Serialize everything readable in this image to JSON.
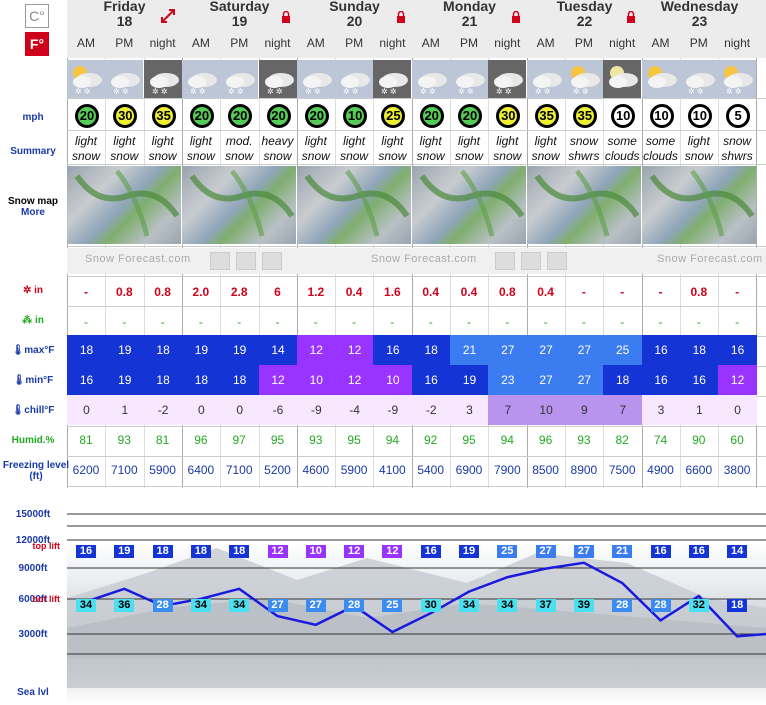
{
  "units": {
    "celsius": "C°",
    "fahrenheit": "F°"
  },
  "days": [
    {
      "name": "Friday",
      "date": "18",
      "icon": "expand-icon"
    },
    {
      "name": "Saturday",
      "date": "19",
      "icon": "lock-icon"
    },
    {
      "name": "Sunday",
      "date": "20",
      "icon": "lock-icon"
    },
    {
      "name": "Monday",
      "date": "21",
      "icon": "lock-icon"
    },
    {
      "name": "Tuesday",
      "date": "22",
      "icon": "lock-icon"
    },
    {
      "name": "Wednesday",
      "date": "23",
      "icon": ""
    }
  ],
  "periods": [
    "AM",
    "PM",
    "night",
    "AM",
    "PM",
    "night",
    "AM",
    "PM",
    "night",
    "AM",
    "PM",
    "night",
    "AM",
    "PM",
    "night",
    "AM",
    "PM",
    "night"
  ],
  "weather_icons": [
    "sun-cloud-snow",
    "cloud-snow",
    "night-cloud-snow",
    "cloud-snow",
    "cloud-snow",
    "night-heavy-snow",
    "cloud-snow",
    "cloud-snow",
    "night-cloud-snow",
    "cloud-snow",
    "cloud-snow",
    "night-cloud-snow",
    "cloud-snow",
    "sun-cloud-snow",
    "moon-cloud",
    "sun-cloud",
    "cloud-snow",
    "sun-cloud-snow"
  ],
  "labels": {
    "wind": "mph",
    "summary": "Summary",
    "snow_map": "Snow map",
    "snow_map_more": "More",
    "snow": "in",
    "rain": "in",
    "max": "max°F",
    "min": "min°F",
    "chill": "chill°F",
    "humid": "Humid.%",
    "freezing": "Freezing level (ft)",
    "alt_15000": "15000ft",
    "alt_12000": "12000ft",
    "alt_9000": "9000ft",
    "alt_6000": "6000ft",
    "alt_3000": "3000ft",
    "alt_sea": "Sea lvl",
    "top_lift": "top lift",
    "bot_lift": "bot lift"
  },
  "wind": [
    "20",
    "30",
    "35",
    "20",
    "20",
    "20",
    "20",
    "10",
    "25",
    "20",
    "20",
    "30",
    "35",
    "35",
    "10",
    "10",
    "10",
    "5"
  ],
  "wind_colors": [
    "#5c5",
    "#ee3",
    "#ee3",
    "#5c5",
    "#5c5",
    "#5c5",
    "#5c5",
    "#5c5",
    "#ee3",
    "#5c5",
    "#5c5",
    "#ee3",
    "#ee3",
    "#ee3",
    "#fff",
    "#fff",
    "#fff",
    "#fff"
  ],
  "summary": [
    [
      "light",
      "snow"
    ],
    [
      "light",
      "snow"
    ],
    [
      "light",
      "snow"
    ],
    [
      "light",
      "snow"
    ],
    [
      "mod.",
      "snow"
    ],
    [
      "heavy",
      "snow"
    ],
    [
      "light",
      "snow"
    ],
    [
      "light",
      "snow"
    ],
    [
      "light",
      "snow"
    ],
    [
      "light",
      "snow"
    ],
    [
      "light",
      "snow"
    ],
    [
      "light",
      "snow"
    ],
    [
      "light",
      "snow"
    ],
    [
      "snow",
      "shwrs"
    ],
    [
      "some",
      "clouds"
    ],
    [
      "some",
      "clouds"
    ],
    [
      "light",
      "snow"
    ],
    [
      "snow",
      "shwrs"
    ]
  ],
  "summary_first": [
    "snow",
    "shwrs"
  ],
  "watermark": "Snow Forecast.com",
  "snow": [
    "-",
    "0.8",
    "0.8",
    "2.0",
    "2.8",
    "6",
    "1.2",
    "0.4",
    "1.6",
    "0.4",
    "0.4",
    "0.8",
    "0.4",
    "-",
    "-",
    "-",
    "0.8",
    "-"
  ],
  "rain": [
    "-",
    "-",
    "-",
    "-",
    "-",
    "-",
    "-",
    "-",
    "-",
    "-",
    "-",
    "-",
    "-",
    "-",
    "-",
    "-",
    "-",
    "-"
  ],
  "max": [
    "18",
    "19",
    "18",
    "19",
    "19",
    "14",
    "12",
    "12",
    "16",
    "18",
    "21",
    "27",
    "27",
    "27",
    "25",
    "16",
    "18",
    "16"
  ],
  "min": [
    "16",
    "19",
    "18",
    "18",
    "18",
    "12",
    "10",
    "12",
    "10",
    "16",
    "19",
    "23",
    "27",
    "27",
    "18",
    "16",
    "16",
    "12"
  ],
  "chill": [
    "0",
    "1",
    "-2",
    "0",
    "0",
    "-6",
    "-9",
    "-4",
    "-9",
    "-2",
    "3",
    "7",
    "10",
    "9",
    "7",
    "3",
    "1",
    "0"
  ],
  "humid": [
    "81",
    "93",
    "81",
    "96",
    "97",
    "95",
    "93",
    "95",
    "94",
    "92",
    "95",
    "94",
    "96",
    "93",
    "82",
    "74",
    "90",
    "60"
  ],
  "freezing": [
    "6200",
    "7100",
    "5900",
    "6400",
    "7100",
    "5200",
    "4600",
    "5900",
    "4100",
    "5400",
    "6900",
    "7900",
    "8500",
    "8900",
    "7500",
    "4900",
    "6600",
    "3800"
  ],
  "top_temps": [
    "16",
    "19",
    "18",
    "18",
    "18",
    "12",
    "10",
    "12",
    "12",
    "16",
    "19",
    "25",
    "27",
    "27",
    "21",
    "16",
    "16",
    "14"
  ],
  "bot_temps": [
    "34",
    "36",
    "28",
    "34",
    "34",
    "27",
    "27",
    "28",
    "25",
    "30",
    "34",
    "34",
    "37",
    "39",
    "28",
    "28",
    "32",
    "18"
  ],
  "colors": {
    "accent": "#d0021b",
    "blue": "#1a3aa8"
  }
}
